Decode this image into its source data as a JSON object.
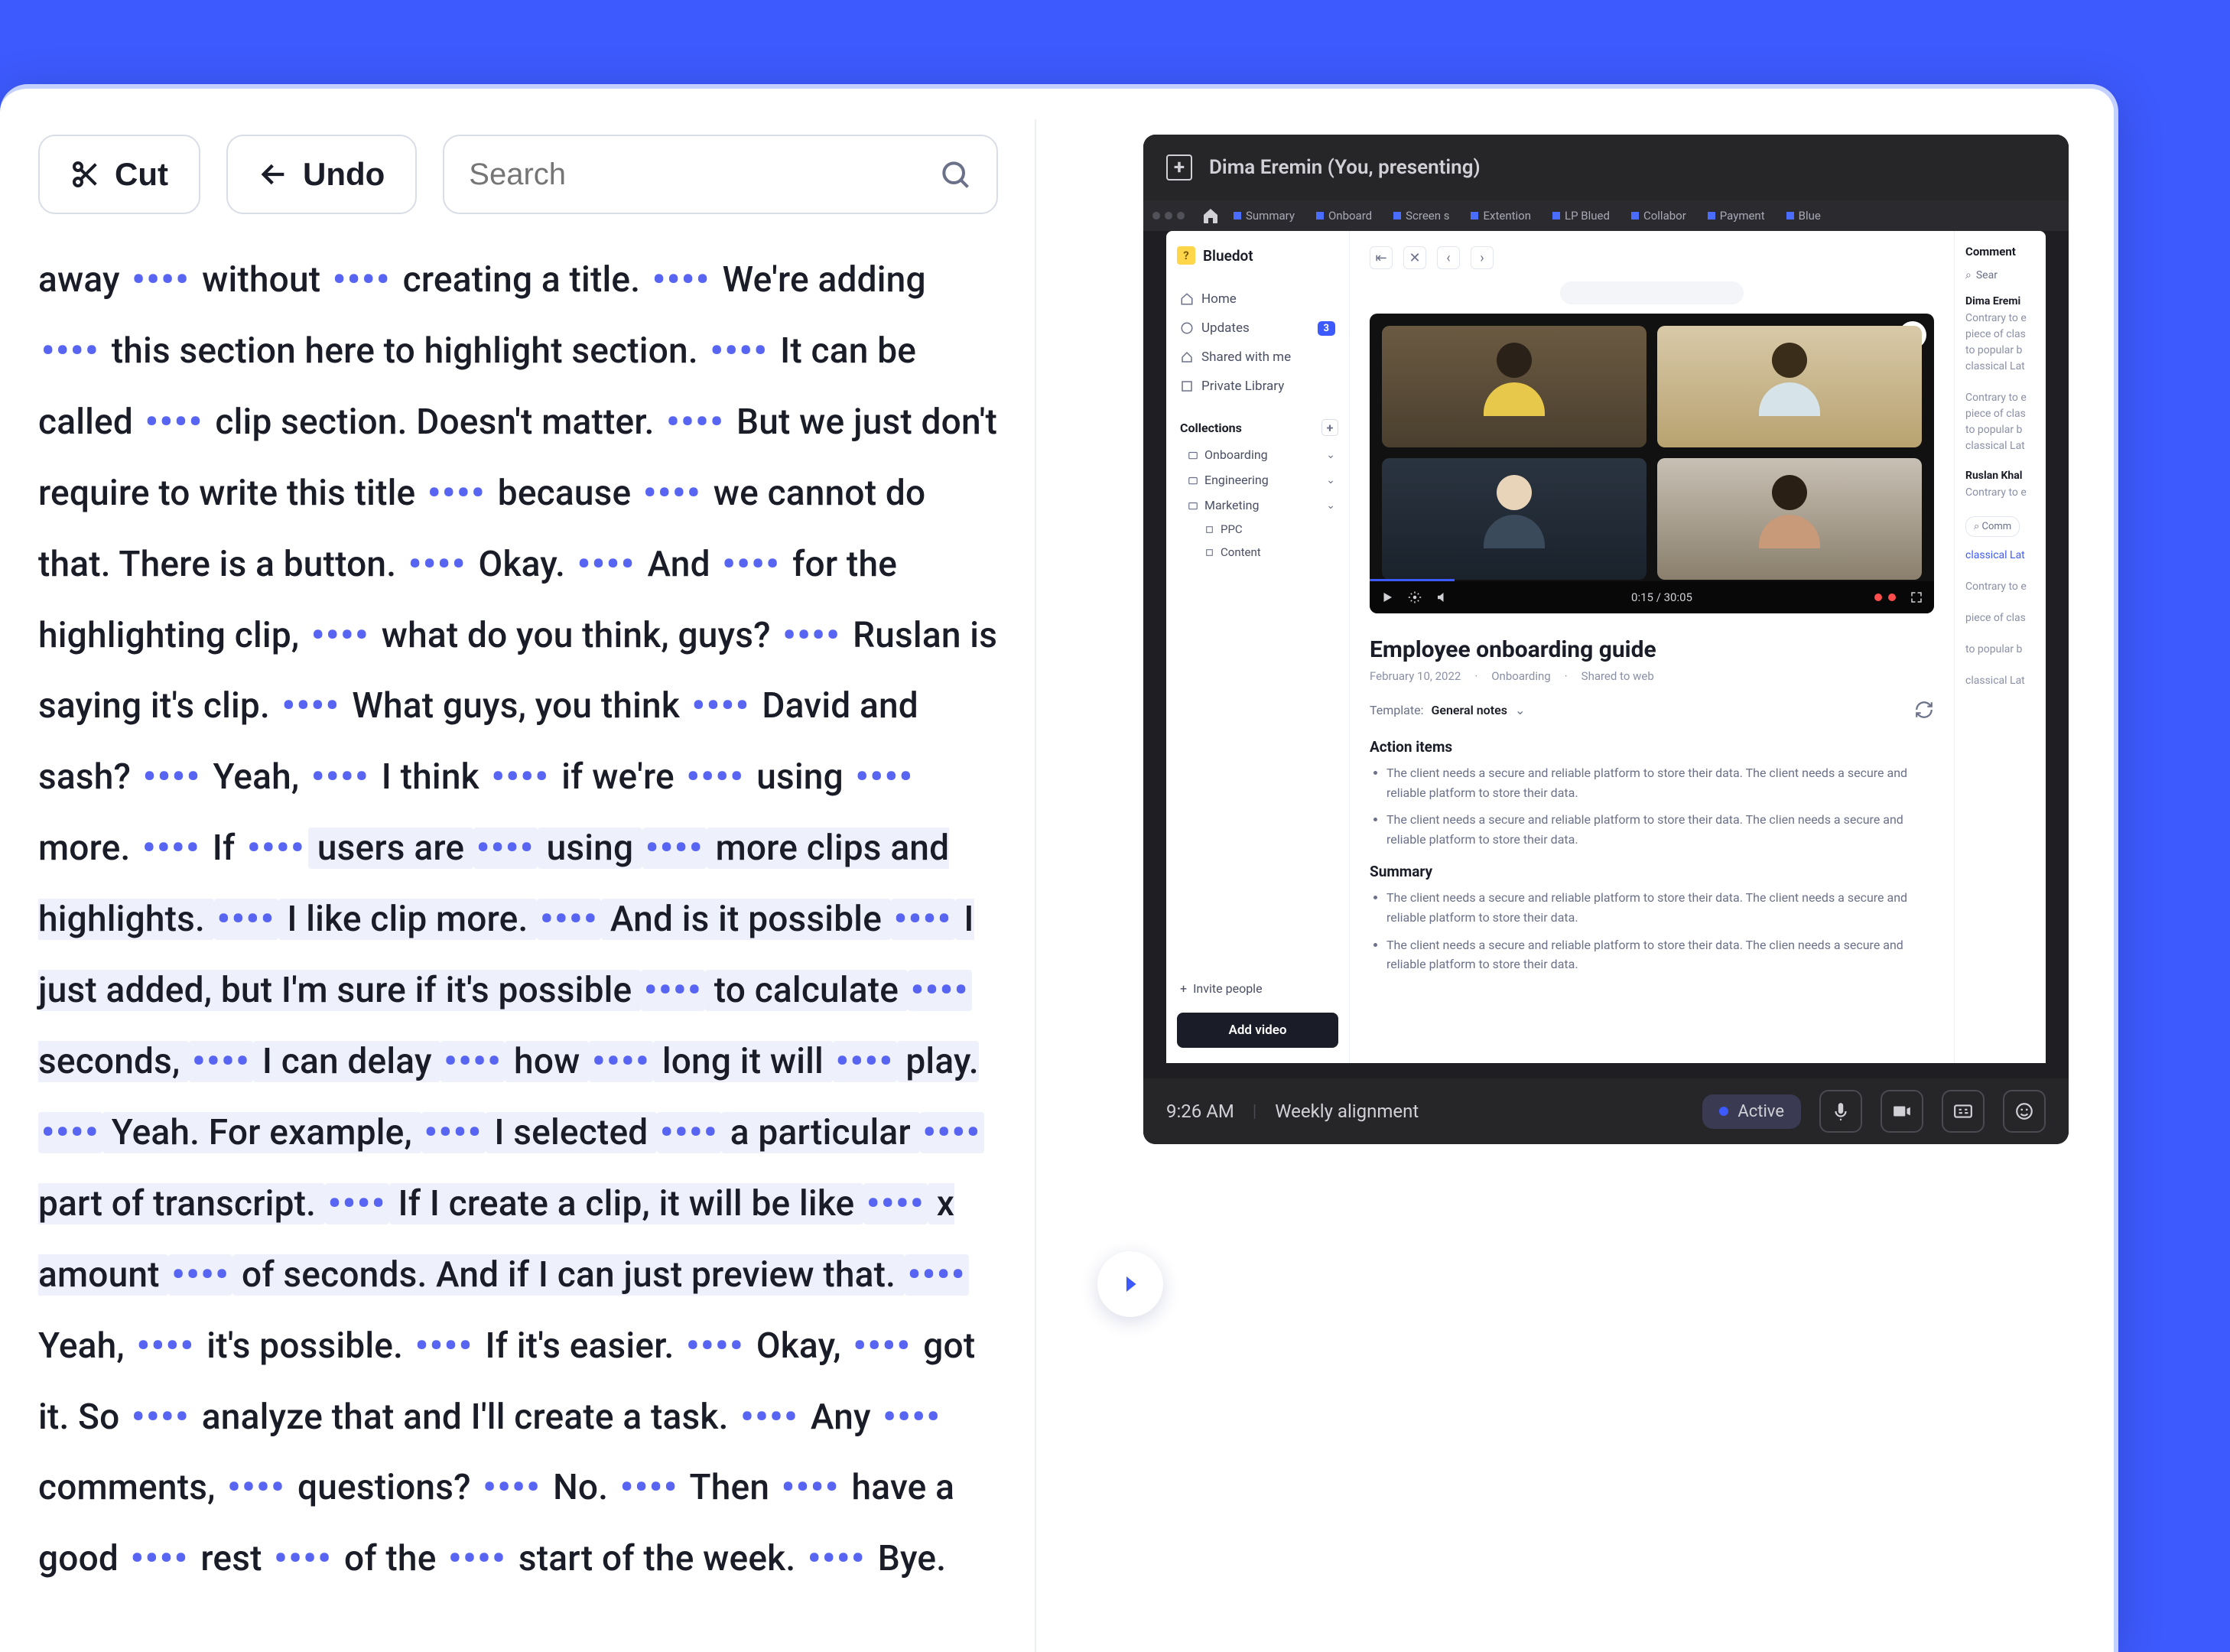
{
  "toolbar": {
    "cut_label": "Cut",
    "undo_label": "Undo",
    "search_placeholder": "Search"
  },
  "transcript": {
    "segments": [
      {
        "t": "away ",
        "d": true
      },
      {
        "t": " without ",
        "d": true
      },
      {
        "t": " creating a title. ",
        "d": true
      },
      {
        "t": " We're adding ",
        "d": true
      },
      {
        "t": " this section here to highlight section. ",
        "d": true
      },
      {
        "t": " It can be called ",
        "d": true
      },
      {
        "t": " clip section. Doesn't matter. ",
        "d": true
      },
      {
        "t": " But we just don't require to write this title ",
        "d": true
      },
      {
        "t": " because ",
        "d": true
      },
      {
        "t": " we cannot do that. There is a button. ",
        "d": true
      },
      {
        "t": " Okay. ",
        "d": true
      },
      {
        "t": " And ",
        "d": true
      },
      {
        "t": " for the highlighting clip, ",
        "d": true
      },
      {
        "t": " what do you think, guys? ",
        "d": true
      },
      {
        "t": " Ruslan is saying it's clip. ",
        "d": true
      },
      {
        "t": " What guys, you think ",
        "d": true
      },
      {
        "t": " David and sash? ",
        "d": true
      },
      {
        "t": " Yeah, ",
        "d": true
      },
      {
        "t": " I think ",
        "d": true
      },
      {
        "t": " if we're ",
        "d": true
      },
      {
        "t": " using ",
        "d": true
      },
      {
        "t": " more. ",
        "d": true
      },
      {
        "t": " If ",
        "d": true
      }
    ],
    "selected_segments": [
      {
        "t": " users are ",
        "d": true
      },
      {
        "t": " using ",
        "d": true
      },
      {
        "t": " more clips and highlights. ",
        "d": true
      },
      {
        "t": " I like clip more. ",
        "d": true
      },
      {
        "t": " And is it possible ",
        "d": true
      },
      {
        "t": " I just added, but I'm sure if it's possible ",
        "d": true
      },
      {
        "t": " to calculate ",
        "d": true
      },
      {
        "t": " seconds, ",
        "d": true
      },
      {
        "t": " I can delay ",
        "d": true
      },
      {
        "t": " how ",
        "d": true
      },
      {
        "t": " long it will ",
        "d": true
      },
      {
        "t": " play. ",
        "d": true
      },
      {
        "t": " Yeah. For example, ",
        "d": true
      },
      {
        "t": " I selected ",
        "d": true
      },
      {
        "t": " a particular ",
        "d": true
      },
      {
        "t": " part of transcript. ",
        "d": true
      },
      {
        "t": " If I create a clip, it will be like ",
        "d": true
      },
      {
        "t": " x amount ",
        "d": true
      },
      {
        "t": " of seconds. And if I can just preview that. ",
        "d": true
      }
    ],
    "tail_segments": [
      {
        "t": " Yeah, ",
        "d": true
      },
      {
        "t": " it's possible. ",
        "d": true
      },
      {
        "t": " If it's easier. ",
        "d": true
      },
      {
        "t": " Okay, ",
        "d": true
      },
      {
        "t": " got it. So ",
        "d": true
      },
      {
        "t": " analyze that and I'll create a task. ",
        "d": true
      },
      {
        "t": " Any ",
        "d": true
      },
      {
        "t": " comments, ",
        "d": true
      },
      {
        "t": " questions? ",
        "d": true
      },
      {
        "t": " No. ",
        "d": true
      },
      {
        "t": " Then ",
        "d": true
      },
      {
        "t": " have a good ",
        "d": true
      },
      {
        "t": " rest ",
        "d": true
      },
      {
        "t": " of the ",
        "d": true
      },
      {
        "t": " start of the week. ",
        "d": true
      },
      {
        "t": " Bye.",
        "d": false
      }
    ]
  },
  "video": {
    "presenter": "Dima Eremin (You, presenting)",
    "tabs": [
      "Summary",
      "Onboard",
      "Screen s",
      "Extention",
      "LP Blued",
      "Collabor",
      "Payment",
      "Blue"
    ],
    "sidebar": {
      "brand": "Bluedot",
      "brand_initial": "?",
      "items": [
        {
          "label": "Home",
          "badge": null
        },
        {
          "label": "Updates",
          "badge": "3"
        },
        {
          "label": "Shared with me",
          "badge": null
        },
        {
          "label": "Private Library",
          "badge": null
        }
      ],
      "collections_label": "Collections",
      "collections": [
        {
          "label": "Onboarding",
          "children": []
        },
        {
          "label": "Engineering",
          "children": []
        },
        {
          "label": "Marketing",
          "children": [
            {
              "label": "PPC"
            },
            {
              "label": "Content"
            }
          ]
        }
      ],
      "invite_label": "Invite people",
      "add_video_label": "Add video"
    },
    "player": {
      "current_time": "0:15",
      "duration": "30:05"
    },
    "document": {
      "title": "Employee onboarding guide",
      "date": "February 10, 2022",
      "folder": "Onboarding",
      "shared": "Shared to web",
      "template_label": "Template:",
      "template_value": "General notes",
      "action_items_label": "Action items",
      "action_items": [
        "The client needs a secure and reliable platform to store their data. The client needs a secure and reliable platform to store their data.",
        "The client needs a secure and reliable platform to store their data. The clien needs a secure and reliable platform to store their data."
      ],
      "summary_label": "Summary",
      "summary": [
        "The client needs a secure and reliable platform to store their data. The client needs a secure and reliable platform to store their data.",
        "The client needs a secure and reliable platform to store their data. The clien needs a secure and reliable platform to store their data."
      ]
    },
    "comments": {
      "header": "Comment",
      "search_label": "Sear",
      "entries": [
        {
          "name": "Dima Eremi",
          "lines": [
            "Contrary to e",
            "piece of clas",
            "to popular b",
            "classical Lat"
          ]
        },
        {
          "name": "",
          "lines": [
            "Contrary to e",
            "piece of clas",
            "to popular b",
            "classical Lat"
          ]
        },
        {
          "name": "Ruslan Khal",
          "lines": [
            "Contrary to e"
          ]
        }
      ],
      "reply_label": "Comm",
      "link_label": "classical Lat",
      "tail_lines": [
        "Contrary to e",
        "piece of clas",
        "to popular b",
        "classical Lat"
      ]
    },
    "bottombar": {
      "time": "9:26 AM",
      "meeting": "Weekly alignment",
      "active_label": "Active"
    }
  }
}
